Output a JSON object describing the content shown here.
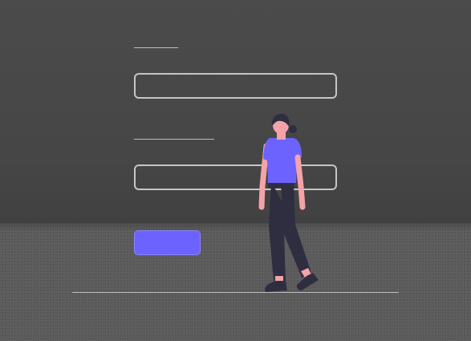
{
  "form": {
    "field1": {
      "label": "",
      "value": "",
      "placeholder": ""
    },
    "field2": {
      "label": "",
      "value": "",
      "placeholder": ""
    },
    "submit_label": ""
  },
  "colors": {
    "accent": "#6c63ff",
    "wall": "#4a4a4a",
    "floor": "#5a5a5a",
    "outline": "#c6c6c6"
  },
  "illustration": {
    "figure": "standing-woman-illustration"
  }
}
